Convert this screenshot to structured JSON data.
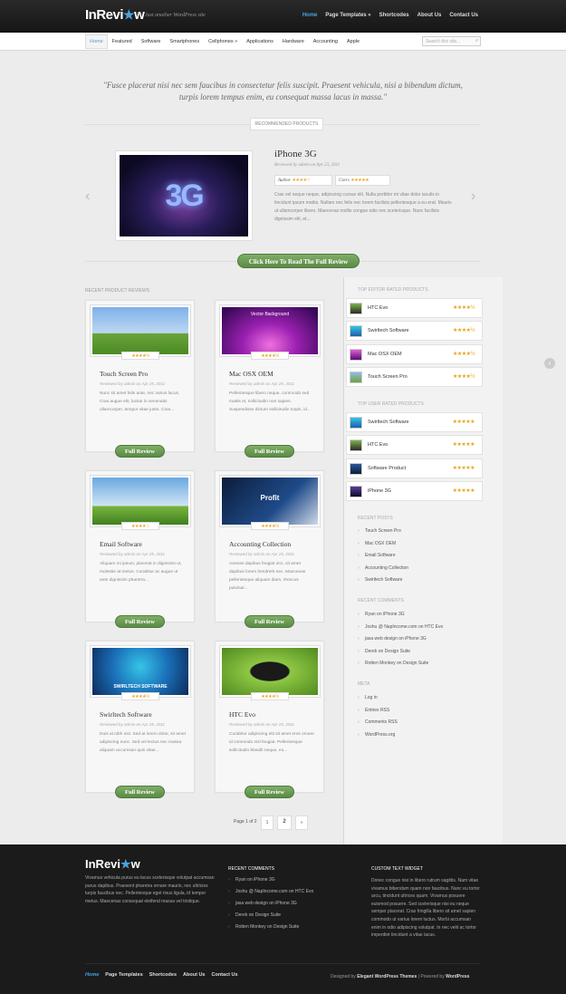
{
  "header": {
    "logo_text": "InRevi",
    "logo_star": "★",
    "logo_end": "w",
    "tagline": "Just another WordPress site",
    "nav": [
      "Home",
      "Page Templates »",
      "Shortcodes",
      "About Us",
      "Contact Us"
    ]
  },
  "categories": {
    "items": [
      "Home",
      "Featured",
      "Software",
      "Smartphones",
      "Cellphones »",
      "Applications",
      "Hardware",
      "Accounting",
      "Apple"
    ],
    "search_placeholder": "Search this site..."
  },
  "quote": "\"Fusce placerat nisi nec sem faucibus in consectetur felis suscipit. Praesent vehicula, nisi a bibendum dictum, turpis lorem tempus enim, eu consequat massa lacus in massa.\"",
  "recommended_label": "Recommended Products",
  "slider": {
    "image_text": "3G",
    "title": "iPhone 3G",
    "reviewed": "Reviewed by admin on Apr 23, 2011",
    "author_label": "Author",
    "users_label": "Users",
    "author_stars": "★★★★☆",
    "users_stars": "★★★★★",
    "description": "Cras vel neque neque, adipiscing cursus elit. Nulla porttitor mi vitae dolor iaculis in tincidunt ipsum mattis. Nullam nec felis nec lorem facilisis pellentesque a eu erat. Mauris ut ullamcorper libero. Maecenas mollis congue odio nec scelerisque. Nunc facilisis dignissim elit, et...",
    "prev": "‹",
    "next": "›",
    "cta": "Click Here To Read The Full Review"
  },
  "recent_label": "Recent Product Reviews",
  "cards": [
    {
      "title": "Touch Screen Pro",
      "reviewed": "Reviewed by admin on Apr 25, 2011",
      "desc": "Nunc sit amet felis ante, nec varius lacus. Cras augue elit, luctus in venenatis ullamcorper, tempor vitae justo. Cras...",
      "stars": "★★★★½",
      "button": "Full Review"
    },
    {
      "title": "Mac OSX OEM",
      "reviewed": "Reviewed by admin on Apr 25, 2011",
      "desc": "Pellentesque libero neque, commodo sed mattis et, sollicitudin non sapien. Suspendisse dictum sollicitudin turpis, id...",
      "stars": "★★★★½",
      "button": "Full Review",
      "image_text": "Vector Background"
    },
    {
      "title": "Email Software",
      "reviewed": "Reviewed by admin on Apr 25, 2011",
      "desc": "Aliquam mi ipsum, placerat in dignissim ut, molestie at metus. Curabitur ac augue ut ante dignissim pharetra...",
      "stars": "★★★★☆",
      "button": "Full Review"
    },
    {
      "title": "Accounting Collection",
      "reviewed": "Reviewed by admin on Apr 25, 2011",
      "desc": "Aenean dapibus feugiat orci, sit amet dapibus lorem hendrerit nec. Maecenas pellentesque aliquam diam, rhoncus pulvinar...",
      "stars": "★★★★½",
      "button": "Full Review",
      "image_text": "Profit"
    },
    {
      "title": "Swirltech Software",
      "reviewed": "Reviewed by admin on Apr 25, 2011",
      "desc": "Duis at nibh nisi. Sed at lorem dolor, sit amet adipiscing nunc. Sed vel lectus nec massa aliquam accumsan quis vitae...",
      "stars": "★★★★½",
      "button": "Full Review",
      "image_text": "SWIRLTECH SOFTWARE"
    },
    {
      "title": "HTC Evo",
      "reviewed": "Reviewed by admin on Apr 25, 2011",
      "desc": "Curabitur adipiscing elit sit amet eros ornare id commodo nisl feugiat. Pellentesque sollicitudin blandit neque, eu...",
      "stars": "★★★★½",
      "button": "Full Review"
    }
  ],
  "pagination": {
    "label": "Page 1 of 2",
    "p1": "1",
    "p2": "2",
    "next": "»"
  },
  "sidebar": {
    "author_label": "Top Editor Rated Products",
    "author_items": [
      {
        "name": "HTC Evo",
        "stars": "★★★★½"
      },
      {
        "name": "Swirltech Software",
        "stars": "★★★★½"
      },
      {
        "name": "Mac OSX OEM",
        "stars": "★★★★½"
      },
      {
        "name": "Touch Screen Pro",
        "stars": "★★★★½"
      }
    ],
    "user_label": "Top User Rated Products",
    "user_items": [
      {
        "name": "Swirltech Software",
        "stars": "★★★★★"
      },
      {
        "name": "HTC Evo",
        "stars": "★★★★★"
      },
      {
        "name": "Software Product",
        "stars": "★★★★★"
      },
      {
        "name": "iPhone 3G",
        "stars": "★★★★★"
      }
    ],
    "recent_posts_label": "Recent Posts",
    "recent_posts": [
      "Touch Screen Pro",
      "Mac OSX OEM",
      "Email Software",
      "Accounting Collection",
      "Swirltech Software"
    ],
    "recent_comments_label": "Recent Comments",
    "recent_comments": [
      "Ryan on iPhone 3G",
      "Joshu @ NapIncome.com on HTC Evo",
      "jasa web design on iPhone 3G",
      "Derek on Design Suite",
      "Rotten Monkey on Design Suite"
    ],
    "meta_label": "Meta",
    "meta": [
      "Log in",
      "Entries RSS",
      "Comments RSS",
      "WordPress.org"
    ]
  },
  "footer": {
    "logo_text": "InRevi",
    "logo_star": "★",
    "logo_end": "w",
    "about": "Vivamus vehicula purus eu lacus scelerisque volutpat accumsan purus dapibus. Praesent pharetra ornare mauris, nec ultricies turpis faucibus nec. Pellentesque eget risus ligula, id tempor metus. Maecenas consequat eleifend massa vel tristique.",
    "comments_label": "Recent Comments",
    "comments": [
      "Ryan on iPhone 3G",
      "Joshu @ NapIncome.com on HTC Evo",
      "jasa web design on iPhone 3G",
      "Derek on Design Suite",
      "Rotten Monkey on Design Suite"
    ],
    "custom_label": "Custom Text Widget",
    "custom_text": "Donec congue nisi in libero rutrum sagittis. Nam vitae vivamus bibendum quam non faucibus. Nunc eu tortor arcu, tincidunt ultrices quam. Vivamus posuere euismod posuere. Sed scelerisque nisi eu neque semper placerat. Cras fringilla libero sit amet sapien commodo ut varius lorem luctus. Morbi accumsan enim in odio adipiscing volutpat. In nec velit ac tortor imperdiet tincidunt a vitae lacus.",
    "nav": [
      "Home",
      "Page Templates",
      "Shortcodes",
      "About Us",
      "Contact Us"
    ],
    "credits_pre": "Designed by",
    "credits_by": "Elegant WordPress Themes",
    "credits_mid": "| Powered by",
    "credits_wp": "WordPress"
  }
}
